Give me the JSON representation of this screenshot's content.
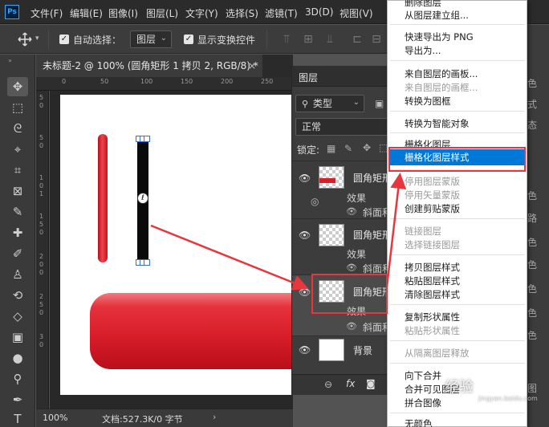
{
  "app": {
    "logo": "Ps"
  },
  "menubar": {
    "items": [
      "文件(F)",
      "编辑(E)",
      "图像(I)",
      "图层(L)",
      "文字(Y)",
      "选择(S)",
      "滤镜(T)",
      "3D(D)",
      "视图(V)"
    ]
  },
  "options": {
    "move_icon": "move-icon",
    "auto_select_label": "自动选择：",
    "auto_select_target": "图层",
    "show_transform_label": "显示变换控件"
  },
  "document": {
    "tab_title": "未标题-2 @ 100% (圆角矩形 1 拷贝 2, RGB/8) *",
    "close_glyph": "×",
    "ruler_h": [
      "0",
      "50",
      "100",
      "150",
      "200",
      "250",
      "300"
    ],
    "ruler_v": [
      "5",
      "0",
      "5",
      "0",
      "1",
      "0",
      "1",
      "5",
      "0",
      "2",
      "0",
      "0",
      "2",
      "5",
      "0",
      "3",
      "0"
    ],
    "ref_glyph": "ℓ"
  },
  "status": {
    "zoom": "100%",
    "doc_info": "文档:527.3K/0 字节",
    "arrow": "›"
  },
  "layers_panel": {
    "tab_title": "图层",
    "filter_label": "类型",
    "blend_mode": "正常",
    "lock_label": "锁定:",
    "layers": [
      {
        "name": "圆角矩形",
        "effects_label": "效果",
        "effect": "斜面和"
      },
      {
        "name": "圆角矩形",
        "effects_label": "效果",
        "effect": "斜面和"
      },
      {
        "name": "圆角矩形",
        "effects_label": "效果",
        "effect": "斜面和"
      },
      {
        "name": "背景"
      }
    ],
    "bottom_fx": "fx"
  },
  "context_menu": {
    "items": [
      {
        "label": "删除图层",
        "disabled": false
      },
      {
        "label": "从图层建立组...",
        "disabled": false
      },
      {
        "label": "快速导出为 PNG",
        "disabled": false
      },
      {
        "label": "导出为...",
        "disabled": false
      },
      {
        "label": "来自图层的画板...",
        "disabled": false
      },
      {
        "label": "来自图层的画框...",
        "disabled": true
      },
      {
        "label": "转换为图框",
        "disabled": false
      },
      {
        "label": "转换为智能对象",
        "disabled": false
      },
      {
        "label": "栅格化图层",
        "disabled": false
      },
      {
        "label": "栅格化图层样式",
        "disabled": false
      },
      {
        "label": "停用图层蒙版",
        "disabled": true
      },
      {
        "label": "停用矢量蒙版",
        "disabled": true
      },
      {
        "label": "创建剪贴蒙版",
        "disabled": false
      },
      {
        "label": "链接图层",
        "disabled": true
      },
      {
        "label": "选择链接图层",
        "disabled": true
      },
      {
        "label": "拷贝图层样式",
        "disabled": false
      },
      {
        "label": "粘贴图层样式",
        "disabled": false
      },
      {
        "label": "清除图层样式",
        "disabled": false
      },
      {
        "label": "复制形状属性",
        "disabled": false
      },
      {
        "label": "粘贴形状属性",
        "disabled": true
      },
      {
        "label": "从隔离图层释放",
        "disabled": true
      },
      {
        "label": "向下合并",
        "disabled": false
      },
      {
        "label": "合并可见图层",
        "disabled": false
      },
      {
        "label": "拼合图像",
        "disabled": false
      },
      {
        "label": "无颜色",
        "disabled": false
      }
    ],
    "highlighted_index": 9
  },
  "right_strip": [
    "色",
    "式",
    "态",
    "色",
    "路",
    "色",
    "色",
    "色",
    "色",
    "色",
    "图"
  ],
  "watermark": {
    "text": "经验",
    "sub": "jingyan.baidu.com"
  },
  "colors": {
    "accent": "#0078d7",
    "annotation_red": "#e8363e",
    "shape_red": "#d81e29"
  }
}
